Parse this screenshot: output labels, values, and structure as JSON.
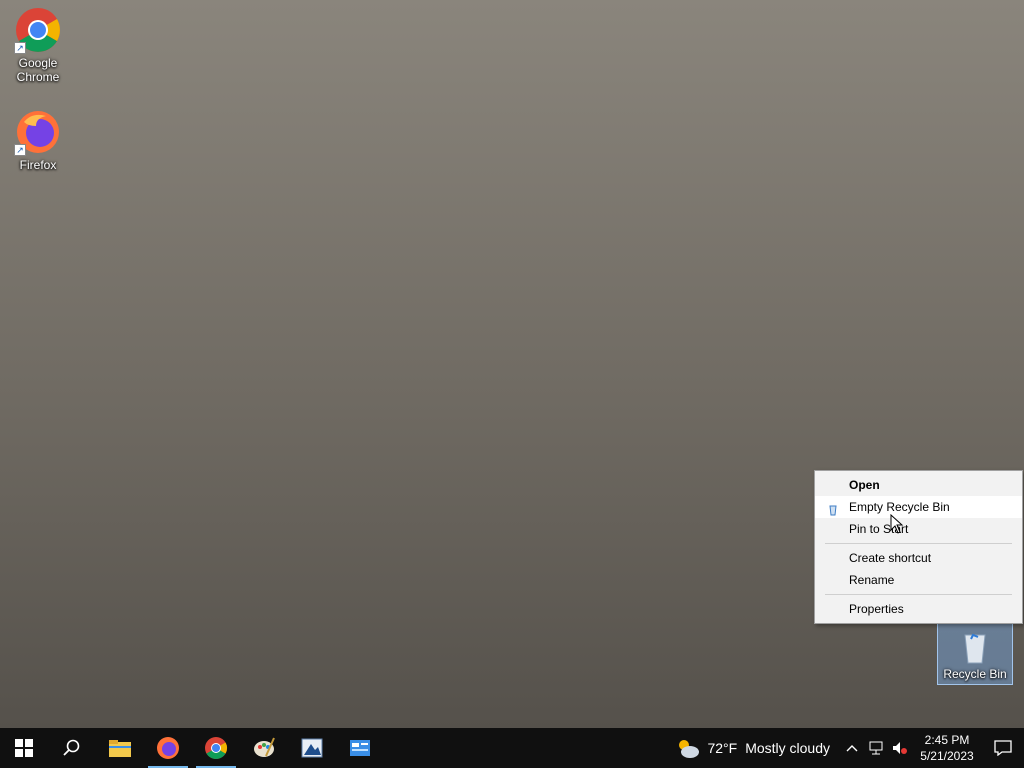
{
  "desktop": {
    "icons": [
      {
        "label": "Google Chrome"
      },
      {
        "label": "Firefox"
      },
      {
        "label": "Recycle Bin"
      }
    ]
  },
  "context_menu": {
    "items": [
      {
        "label": "Open",
        "bold": true
      },
      {
        "label": "Empty Recycle Bin",
        "hover": true
      },
      {
        "label": "Pin to Start"
      },
      {
        "label": "Create shortcut"
      },
      {
        "label": "Rename"
      },
      {
        "label": "Properties"
      }
    ]
  },
  "taskbar": {
    "apps": [
      "start-icon",
      "search-icon",
      "file-explorer-icon",
      "firefox-icon",
      "chrome-icon",
      "paint-icon",
      "app-icon",
      "control-panel-icon"
    ],
    "weather": {
      "temp": "72°F",
      "condition": "Mostly cloudy"
    },
    "clock": {
      "time": "2:45 PM",
      "date": "5/21/2023"
    }
  },
  "colors": {
    "taskbar": "#101010",
    "menu_bg": "#f2f2f2",
    "accent": "#76b9ed"
  }
}
